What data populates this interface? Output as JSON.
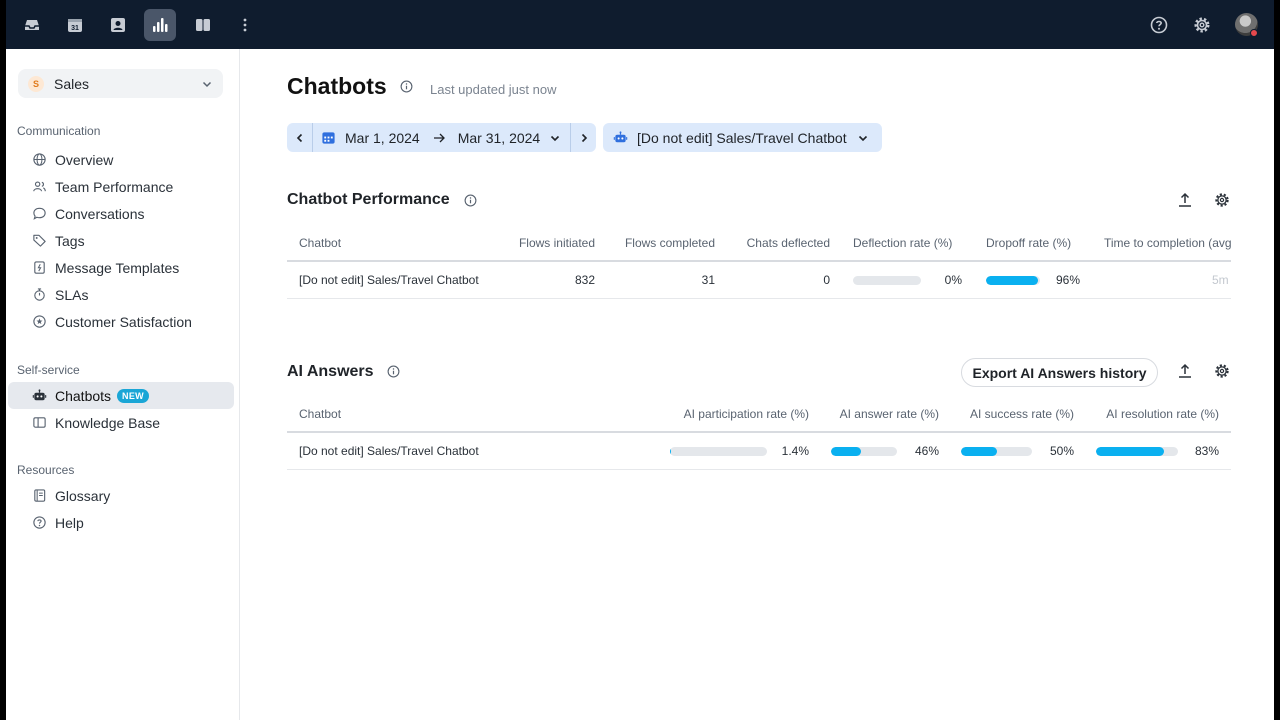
{
  "topbar": {
    "icons": [
      "inbox-icon",
      "calendar-icon",
      "contacts-icon",
      "analytics-icon",
      "knowledge-icon",
      "more-icon"
    ],
    "active": "analytics-icon",
    "right_icons": [
      "help-icon",
      "settings-icon",
      "avatar"
    ]
  },
  "sidebar": {
    "team": {
      "badge": "S",
      "label": "Sales"
    },
    "sections": [
      {
        "title": "Communication",
        "items": [
          {
            "label": "Overview",
            "icon": "globe-icon"
          },
          {
            "label": "Team Performance",
            "icon": "people-icon"
          },
          {
            "label": "Conversations",
            "icon": "chat-icon"
          },
          {
            "label": "Tags",
            "icon": "tag-icon"
          },
          {
            "label": "Message Templates",
            "icon": "template-icon"
          },
          {
            "label": "SLAs",
            "icon": "timer-icon"
          },
          {
            "label": "Customer Satisfaction",
            "icon": "star-icon"
          }
        ]
      },
      {
        "title": "Self-service",
        "items": [
          {
            "label": "Chatbots",
            "icon": "bot-icon",
            "badge": "NEW",
            "active": true
          },
          {
            "label": "Knowledge Base",
            "icon": "book-icon"
          }
        ]
      },
      {
        "title": "Resources",
        "items": [
          {
            "label": "Glossary",
            "icon": "glossary-icon"
          },
          {
            "label": "Help",
            "icon": "help-icon"
          }
        ]
      }
    ]
  },
  "header": {
    "title": "Chatbots",
    "last_updated": "Last updated just now"
  },
  "filters": {
    "date_start": "Mar 1, 2024",
    "date_end": "Mar 31, 2024",
    "chatbot": "[Do not edit] Sales/Travel Chatbot"
  },
  "performance": {
    "title": "Chatbot Performance",
    "columns": [
      "Chatbot",
      "Flows initiated",
      "Flows completed",
      "Chats deflected",
      "Deflection rate (%)",
      "Dropoff rate (%)",
      "Time to completion (avg)"
    ],
    "rows": [
      {
        "chatbot": "[Do not edit] Sales/Travel Chatbot",
        "flows_initiated": "832",
        "flows_completed": "31",
        "chats_deflected": "0",
        "deflection_rate": 0,
        "deflection_rate_label": "0%",
        "dropoff_rate": 96,
        "dropoff_rate_label": "96%",
        "time_to_completion": "5m"
      }
    ]
  },
  "ai_answers": {
    "title": "AI Answers",
    "export_label": "Export AI Answers history",
    "columns": [
      "Chatbot",
      "AI participation rate (%)",
      "AI answer rate (%)",
      "AI success rate (%)",
      "AI resolution rate (%)"
    ],
    "rows": [
      {
        "chatbot": "[Do not edit] Sales/Travel Chatbot",
        "participation": 1.4,
        "participation_label": "1.4%",
        "answer": 46,
        "answer_label": "46%",
        "success": 50,
        "success_label": "50%",
        "resolution": 83,
        "resolution_label": "83%"
      }
    ]
  },
  "colors": {
    "topbar": "#0f1c2e",
    "accent": "#0ab0f0",
    "filter_bg": "#dce9fb",
    "new_badge": "#1aa6d6"
  }
}
